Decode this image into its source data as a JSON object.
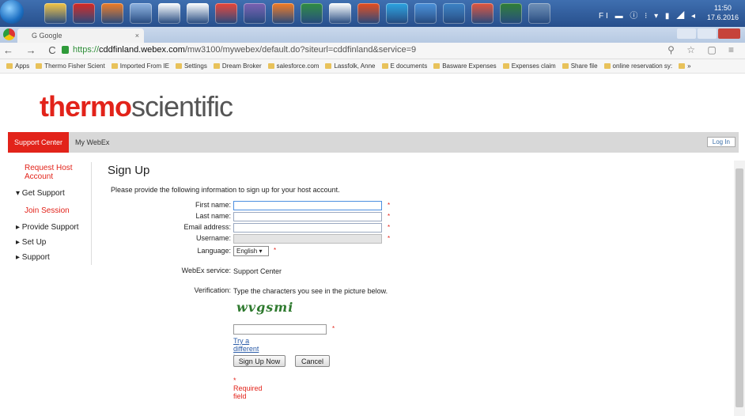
{
  "taskbar": {
    "time": "11:50",
    "date": "17.6.2016",
    "tray_icons": "FI ▬ ⓘ ⁝ ▾ ▮ ◢ ◂",
    "app_colors": [
      "#f4c542",
      "#d7261e",
      "#f07b22",
      "#8fb3e0",
      "#ffffff",
      "#ffffff",
      "#ea4335",
      "#7a5fb0",
      "#f47a20",
      "#2e8b3e",
      "#ffffff",
      "#e64a19",
      "#2aa2e0",
      "#4a90d9",
      "#3b82c4",
      "#e2533a",
      "#2e7d32",
      "#6f8fb5"
    ]
  },
  "browser": {
    "tab_title": "G Google",
    "tab_close": "×",
    "nav_buttons": "← → C",
    "url_scheme": "https://",
    "url_host": "cddfinland.webex.com",
    "url_path": "/mw3100/mywebex/default.do?siteurl=cddfinland&service=9",
    "toolbar_right": "⚲ ☆ ▢ ≡",
    "bookmarks": [
      "Apps",
      "Thermo Fisher Scient",
      "Imported From IE",
      "Settings",
      "Dream Broker",
      "salesforce.com",
      "Lassfolk, Anne",
      "E documents",
      "Basware Expenses",
      "Expenses claim",
      "Share file",
      "online reservation sy:",
      "»"
    ]
  },
  "logo": {
    "part1": "thermo",
    "part2": "scientific"
  },
  "navbar": {
    "support_center": "Support Center",
    "my_webex": "My WebEx",
    "login": "Log In"
  },
  "sidebar": {
    "request_host_line1": "Request Host",
    "request_host_line2": "Account",
    "get_support": "▾ Get Support",
    "join_session": "Join Session",
    "provide_support": "▸ Provide Support",
    "set_up": "▸ Set Up",
    "support": "▸ Support"
  },
  "form": {
    "title": "Sign Up",
    "intro": "Please provide the following information to sign up for your host account.",
    "first_name_label": "First name:",
    "last_name_label": "Last name:",
    "email_label": "Email address:",
    "username_label": "Username:",
    "language_label": "Language:",
    "language_value": "English ▾",
    "required_mark": "*",
    "webex_service_label": "WebEx service:",
    "webex_service_value": "Support Center",
    "verification_label": "Verification:",
    "verification_text": "Type the characters you see in the picture below.",
    "captcha_text": "wvgsmi",
    "different_image": "Try a different image",
    "sign_up_button": "Sign Up Now",
    "cancel_button": "Cancel",
    "required_note": "* Required field"
  }
}
